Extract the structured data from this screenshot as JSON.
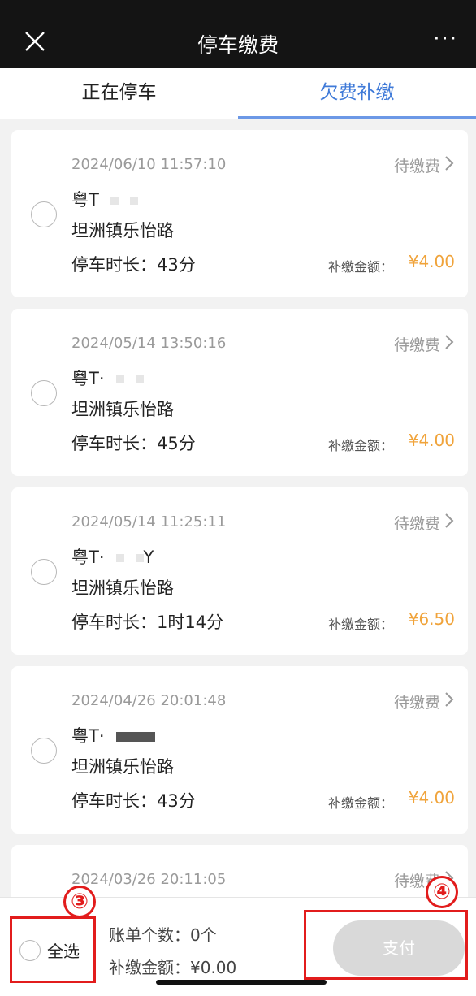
{
  "titlebar": {
    "title": "停车缴费",
    "close_icon": "close-icon",
    "more_label": "···"
  },
  "tabs": [
    {
      "label": "正在停车",
      "active": false
    },
    {
      "label": "欠费补缴",
      "active": true
    }
  ],
  "cards": [
    {
      "time": "2024/06/10 11:57:10",
      "status": "待缴费",
      "plate": "粤T",
      "place": "坦洲镇乐怡路",
      "duration": "停车时长：43分",
      "amount_label": "补缴金额：",
      "amount": "¥4.00"
    },
    {
      "time": "2024/05/14 13:50:16",
      "status": "待缴费",
      "plate": "粤T·",
      "place": "坦洲镇乐怡路",
      "duration": "停车时长：45分",
      "amount_label": "补缴金额：",
      "amount": "¥4.00"
    },
    {
      "time": "2024/05/14 11:25:11",
      "status": "待缴费",
      "plate": "粤T·",
      "plate_suffix": "Y",
      "place": "坦洲镇乐怡路",
      "duration": "停车时长：1时14分",
      "amount_label": "补缴金额：",
      "amount": "¥6.50"
    },
    {
      "time": "2024/04/26 20:01:48",
      "status": "待缴费",
      "plate": "粤T·",
      "place": "坦洲镇乐怡路",
      "duration": "停车时长：43分",
      "amount_label": "补缴金额：",
      "amount": "¥4.00"
    },
    {
      "time": "2024/03/26 20:11:05",
      "status": "待缴费"
    }
  ],
  "bottombar": {
    "select_all": "全选",
    "count": "账单个数：0个",
    "total": "补缴金额：¥0.00",
    "pay": "支付"
  },
  "annotations": [
    "③",
    "④"
  ],
  "colors": {
    "accent_blue": "#3f7ad8",
    "amount_orange": "#f0a33a",
    "annotation_red": "#e21c1c"
  }
}
